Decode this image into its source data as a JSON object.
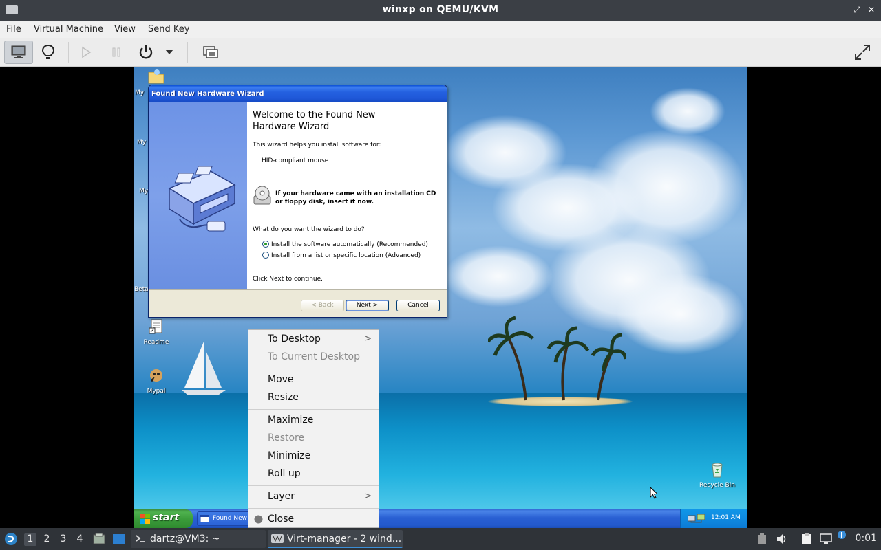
{
  "window": {
    "title": "winxp on QEMU/KVM"
  },
  "menubar": {
    "items": [
      "File",
      "Virtual Machine",
      "View",
      "Send Key"
    ]
  },
  "desktop": {
    "icons": [
      {
        "label": "Readme"
      },
      {
        "label": "Mypal"
      },
      {
        "label": "Recycle Bin"
      }
    ],
    "partial_labels": [
      "My",
      "My",
      "My",
      "Beta"
    ]
  },
  "wizard": {
    "caption": "Found New Hardware Wizard",
    "heading_line1": "Welcome to the Found New",
    "heading_line2": "Hardware Wizard",
    "intro": "This wizard helps you install software for:",
    "device": "HID-compliant mouse",
    "cd_line1": "If your hardware came with an installation CD",
    "cd_line2": "or floppy disk, insert it now.",
    "question": "What do you want the wizard to do?",
    "option_auto": "Install the software automatically (Recommended)",
    "option_manual": "Install from a list or specific location (Advanced)",
    "continue": "Click Next to continue.",
    "back": "< Back",
    "next": "Next >",
    "cancel": "Cancel"
  },
  "xp_taskbar": {
    "start": "start",
    "task": "Found New",
    "clock": "12:01 AM"
  },
  "context_menu": {
    "to_desktop": "To Desktop",
    "to_current_desktop": "To Current Desktop",
    "move": "Move",
    "resize": "Resize",
    "maximize": "Maximize",
    "restore": "Restore",
    "minimize": "Minimize",
    "roll_up": "Roll up",
    "layer": "Layer",
    "close": "Close"
  },
  "panel": {
    "workspaces": [
      "1",
      "2",
      "3",
      "4"
    ],
    "tasks": [
      "dartz@VM3: ~",
      "Virt-manager - 2 wind..."
    ],
    "clock": "0:01"
  }
}
